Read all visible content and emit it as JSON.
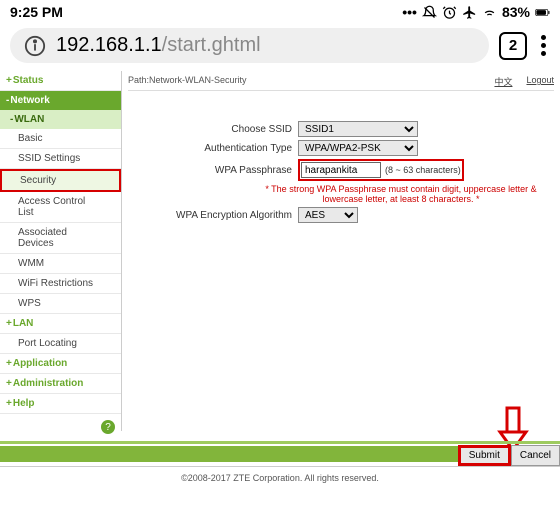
{
  "status": {
    "time": "9:25 PM",
    "battery": "83%"
  },
  "address": {
    "host": "192.168.1.1",
    "path": "/start.ghtml",
    "tab_count": "2"
  },
  "sidebar": {
    "status": "Status",
    "network": "Network",
    "wlan": "WLAN",
    "subs": {
      "basic": "Basic",
      "ssid": "SSID Settings",
      "security": "Security",
      "acl": "Access Control List",
      "assoc": "Associated Devices",
      "wmm": "WMM",
      "wifir": "WiFi Restrictions",
      "wps": "WPS"
    },
    "lan": "LAN",
    "port": "Port Locating",
    "app": "Application",
    "admin": "Administration",
    "help": "Help"
  },
  "crumb": {
    "path": "Path:Network-WLAN-Security",
    "lang": "中文",
    "logout": "Logout"
  },
  "form": {
    "ssid_label": "Choose SSID",
    "ssid_value": "SSID1",
    "auth_label": "Authentication Type",
    "auth_value": "WPA/WPA2-PSK",
    "pass_label": "WPA Passphrase",
    "pass_value": "harapankita",
    "pass_hint": "(8 ~ 63 characters)",
    "warn": "* The strong WPA Passphrase must contain digit, uppercase letter & lowercase letter, at least 8 characters. *",
    "enc_label": "WPA Encryption Algorithm",
    "enc_value": "AES"
  },
  "buttons": {
    "submit": "Submit",
    "cancel": "Cancel"
  },
  "footer": "©2008-2017 ZTE Corporation. All rights reserved."
}
